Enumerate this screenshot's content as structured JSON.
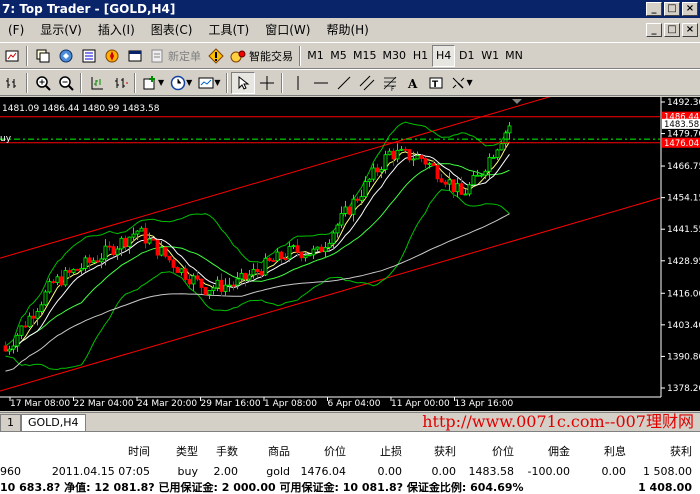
{
  "window": {
    "title": "7: Top Trader - [GOLD,H4]"
  },
  "menu": [
    "(F)",
    "显示(V)",
    "插入(I)",
    "图表(C)",
    "工具(T)",
    "窗口(W)",
    "帮助(H)"
  ],
  "toolbar1": {
    "new_order": "新定单",
    "expert_advisors": "智能交易",
    "timeframes": [
      "M1",
      "M5",
      "M15",
      "M30",
      "H1",
      "H4",
      "D1",
      "W1",
      "MN"
    ],
    "active_timeframe": "H4"
  },
  "chart": {
    "ohlc_text": "1481.09 1486.44 1480.99 1483.58",
    "order_label": "uy",
    "price_ticks": [
      "1492.30",
      "1479.70",
      "1466.75",
      "1454.15",
      "1441.55",
      "1428.95",
      "1416.00",
      "1403.40",
      "1390.80",
      "1378.20"
    ],
    "price_tick_values": [
      1492.3,
      1479.7,
      1466.75,
      1454.15,
      1441.55,
      1428.95,
      1416.0,
      1403.4,
      1390.8,
      1378.2
    ],
    "time_ticks": [
      "17 Mar 08:00",
      "22 Mar 04:00",
      "24 Mar 20:00",
      "29 Mar 16:00",
      "1 Apr 08:00",
      "6 Apr 04:00",
      "11 Apr 00:00",
      "13 Apr 16:00"
    ],
    "price_tags": [
      {
        "text": "1486.44",
        "value": 1486.44,
        "color": "#ff0000"
      },
      {
        "text": "1483.58",
        "value": 1483.58,
        "color": "#ffffff"
      },
      {
        "text": "1476.04",
        "value": 1476.04,
        "color": "#ff0000"
      }
    ],
    "colors": {
      "bull": "#00ff00",
      "bear": "#ff0000",
      "channel": "#ff0000",
      "bollinger": "#00c000",
      "ma_fast": "#ffff80",
      "ma_mid": "#40ff40",
      "ma_slow": "#c8c8c8",
      "entry": "#00ff00"
    }
  },
  "tabs": {
    "first": "1",
    "active": "GOLD,H4"
  },
  "watermark": "http://www.0071c.com--007理财网",
  "terminal": {
    "headers": [
      "时间",
      "类型",
      "手数",
      "商品",
      "价位",
      "止损",
      "获利",
      "价位",
      "佣金",
      "利息",
      "获利"
    ],
    "order": {
      "ticket": "960",
      "time": "2011.04.15 07:05",
      "type": "buy",
      "lots": "2.00",
      "symbol": "gold",
      "open_price": "1476.04",
      "sl": "0.00",
      "tp": "0.00",
      "price": "1483.58",
      "commission": "-100.00",
      "swap": "0.00",
      "profit": "1 508.00"
    },
    "summary": "10 683.8? 净值: 12 081.8? 已用保证金: 2 000.00 可用保证金: 10 081.8? 保证金比例: 604.69%",
    "summary_profit": "1 408.00"
  }
}
